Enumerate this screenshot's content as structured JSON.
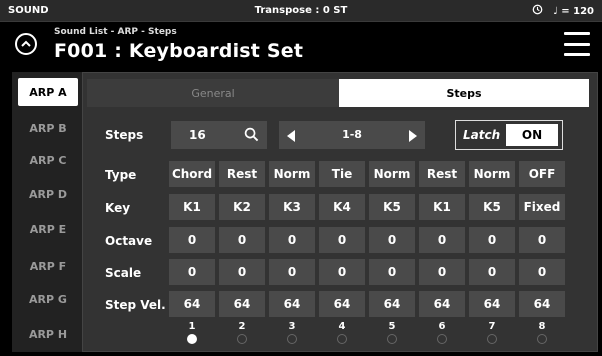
{
  "status": {
    "mode": "SOUND",
    "transpose": "Transpose : 0 ST",
    "tempo": "♩ = 120"
  },
  "header": {
    "breadcrumb": "Sound List - ARP - Steps",
    "title": "F001 : Keyboardist Set"
  },
  "sidebar": {
    "items": [
      "ARP A",
      "ARP B",
      "ARP C",
      "ARP D",
      "ARP E",
      "ARP F",
      "ARP G",
      "ARP H"
    ],
    "active_index": 0
  },
  "tabs": {
    "general": "General",
    "steps": "Steps",
    "active": "Steps"
  },
  "controls": {
    "steps_label": "Steps",
    "steps_value": "16",
    "range_value": "1-8",
    "latch_label": "Latch",
    "latch_value": "ON"
  },
  "grid": {
    "rows": [
      {
        "label": "Type",
        "values": [
          "Chord",
          "Rest",
          "Norm",
          "Tie",
          "Norm",
          "Rest",
          "Norm",
          "OFF"
        ]
      },
      {
        "label": "Key",
        "values": [
          "K1",
          "K2",
          "K3",
          "K4",
          "K5",
          "K1",
          "K5",
          "Fixed"
        ]
      },
      {
        "label": "Octave",
        "values": [
          "0",
          "0",
          "0",
          "0",
          "0",
          "0",
          "0",
          "0"
        ]
      },
      {
        "label": "Scale",
        "values": [
          "0",
          "0",
          "0",
          "0",
          "0",
          "0",
          "0",
          "0"
        ]
      },
      {
        "label": "Step Vel.",
        "values": [
          "64",
          "64",
          "64",
          "64",
          "64",
          "64",
          "64",
          "64"
        ]
      }
    ],
    "step_numbers": [
      "1",
      "2",
      "3",
      "4",
      "5",
      "6",
      "7",
      "8"
    ],
    "active_step": 1
  },
  "icons": [
    "clock-icon",
    "back-circle-icon",
    "menu-icon",
    "search-icon",
    "triangle-left-icon",
    "triangle-right-icon"
  ]
}
